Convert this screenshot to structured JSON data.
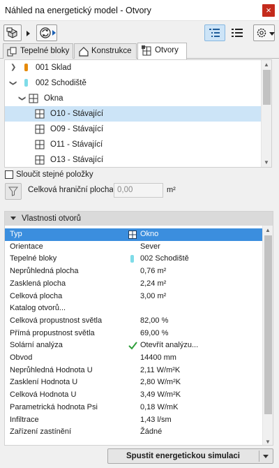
{
  "window": {
    "title": "Náhled na energetický model - Otvory",
    "close_label": "×"
  },
  "toolbar": {
    "icons": [
      "model-3d-icon",
      "refresh-icon",
      "tree-view-icon",
      "list-view-icon",
      "settings-icon"
    ]
  },
  "tabs": [
    {
      "label": "Tepelné bloky",
      "icon": "blocks-icon"
    },
    {
      "label": "Konstrukce",
      "icon": "house-icon"
    },
    {
      "label": "Otvory",
      "icon": "window-icon",
      "active": true
    }
  ],
  "tree": {
    "items": [
      {
        "label": "001 Sklad",
        "marker_color": "#e58a0a",
        "expanded": false
      },
      {
        "label": "002 Schodiště",
        "marker_color": "#7fdce8",
        "expanded": true
      },
      {
        "label": "Okna",
        "expanded": true
      },
      {
        "label": "O10 - Stávající",
        "selected": true
      },
      {
        "label": "O09 - Stávající"
      },
      {
        "label": "O11 - Stávající"
      },
      {
        "label": "O13 - Stávající"
      }
    ]
  },
  "merge": {
    "label": "Sloučit stejné položky",
    "checked": false
  },
  "area": {
    "label": "Celková hraniční plocha:",
    "value": "0,00",
    "unit": "m²"
  },
  "properties": {
    "header": "Vlastnosti otvorů",
    "rows": [
      {
        "key": "Typ",
        "value": "Okno",
        "selected": true
      },
      {
        "key": "Orientace",
        "value": "Sever"
      },
      {
        "key": "Tepelné bloky",
        "value": "002 Schodiště"
      },
      {
        "key": "Neprůhledná plocha",
        "value": "0,76 m²"
      },
      {
        "key": "Zasklená plocha",
        "value": "2,24 m²"
      },
      {
        "key": "Celková plocha",
        "value": "3,00 m²"
      },
      {
        "key": "Katalog otvorů...",
        "value": ""
      },
      {
        "key": "Celková propustnost světla",
        "value": "82,00 %"
      },
      {
        "key": "Přímá propustnost světla",
        "value": "69,00 %"
      },
      {
        "key": "Solární analýza",
        "value": "Otevřít analýzu..."
      },
      {
        "key": "Obvod",
        "value": "14400 mm"
      },
      {
        "key": "Neprůhledná Hodnota U",
        "value": "2,11 W/m²K"
      },
      {
        "key": "Zasklení Hodnota U",
        "value": "2,80 W/m²K"
      },
      {
        "key": "Celková Hodnota U",
        "value": "3,49 W/m²K"
      },
      {
        "key": "Parametrická hodnota Psi",
        "value": "0,18 W/mK"
      },
      {
        "key": "Infiltrace",
        "value": "1,43 l/sm"
      },
      {
        "key": "Zařízení zastínění",
        "value": "Žádné"
      }
    ]
  },
  "footer": {
    "run_label": "Spustit energetickou simulaci"
  },
  "colors": {
    "selection_blue": "#3b8ede",
    "tree_selection": "#cce4f7",
    "close_red": "#c42b1c",
    "check_green": "#2e9e3a"
  }
}
